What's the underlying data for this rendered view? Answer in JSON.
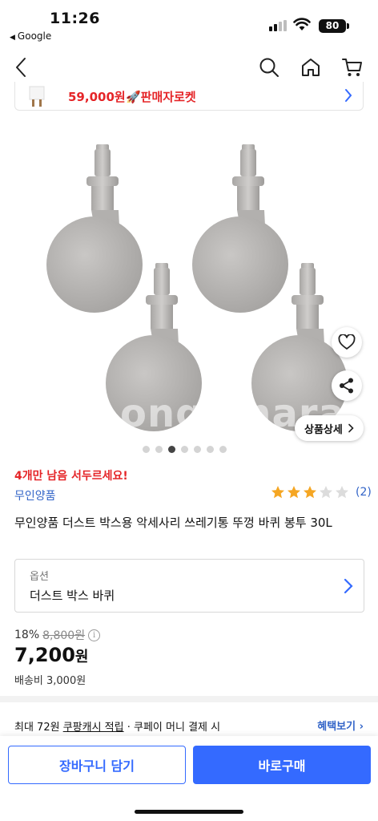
{
  "status_bar": {
    "time": "11:26",
    "back_app": "Google",
    "battery": "80"
  },
  "seller_strip": {
    "price": "59,000원",
    "rocket_label": "🚀판매자로켓"
  },
  "gallery": {
    "watermark": "ongomara",
    "detail_button": "상품상세",
    "page_count": 7,
    "active_page": 3
  },
  "product": {
    "stock_notice": "4개만 남음 서두르세요!",
    "brand": "무인양품",
    "rating": 3,
    "rating_max": 5,
    "review_count": "(2)",
    "title": "무인양품 더스트 박스용 악세사리 쓰레기통 뚜껑 바퀴 봉투 30L"
  },
  "option": {
    "label": "옵션",
    "value": "더스트 박스 바퀴"
  },
  "pricing": {
    "discount_rate": "18%",
    "original_price": "8,800원",
    "info_icon_glyph": "i",
    "sale_price": "7,200",
    "sale_unit": "원",
    "shipping": "배송비 3,000원"
  },
  "cash": {
    "prefix": "최대 72원",
    "link": "쿠팡캐시 적립",
    "suffix": "· 쿠페이 머니 결제 시",
    "benefit": "혜택보기 ›"
  },
  "actions": {
    "cart": "장바구니 담기",
    "buy": "바로구매"
  },
  "colors": {
    "accent_blue": "#346aff",
    "alert_red": "#e52528",
    "link_blue": "#3264c8",
    "star": "#f5a623"
  }
}
